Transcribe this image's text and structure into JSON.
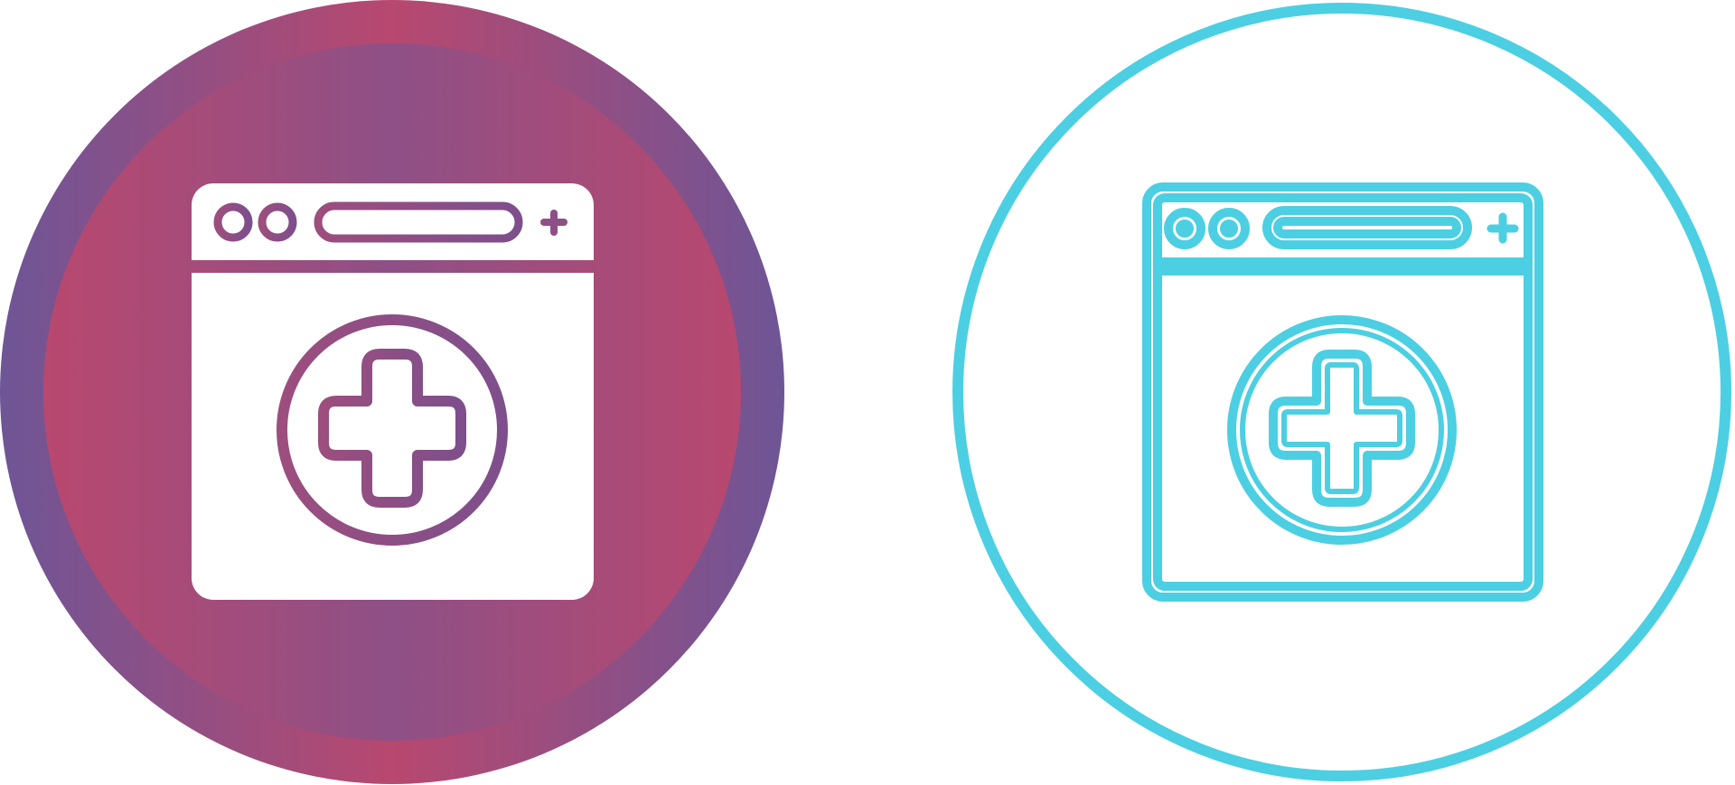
{
  "icons": [
    {
      "name": "medical-browser-gradient-icon",
      "style": "filled-gradient",
      "colors": {
        "gradient_purple": "#6e5596",
        "gradient_pink": "#b8486f",
        "fill": "#ffffff"
      }
    },
    {
      "name": "medical-browser-outline-icon",
      "style": "outline",
      "colors": {
        "stroke": "#4ccfe2",
        "fill": "#ffffff"
      }
    }
  ]
}
